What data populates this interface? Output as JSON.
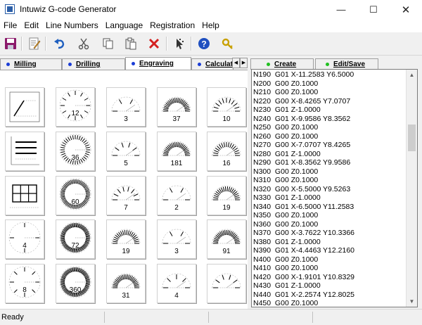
{
  "window": {
    "title": "Intuwiz G-code Generator",
    "controls": [
      "minimize-icon",
      "maximize-icon",
      "close-icon"
    ]
  },
  "menu": [
    "File",
    "Edit",
    "Line Numbers",
    "Language",
    "Registration",
    "Help"
  ],
  "toolbar": {
    "buttons": [
      "save-icon",
      "edit-icon",
      "undo-icon",
      "cut-icon",
      "copy-icon",
      "paste-icon",
      "delete-icon",
      "pointer-icon",
      "help-icon",
      "key-icon"
    ]
  },
  "tabs": [
    {
      "label": "Milling",
      "active": false
    },
    {
      "label": "Drilling",
      "active": false
    },
    {
      "label": "Engraving",
      "active": true
    },
    {
      "label": "Calculators",
      "active": false
    }
  ],
  "tab_dot_color": "#1a3cd6",
  "right_tabs": [
    {
      "label": "Create"
    },
    {
      "label": "Edit/Save"
    }
  ],
  "right_tab_dot_color": "#20c020",
  "tiles": [
    [
      "",
      "12",
      "3",
      "37",
      "10"
    ],
    [
      "",
      "36",
      "5",
      "181",
      "16"
    ],
    [
      "",
      "60",
      "7",
      "2",
      "19"
    ],
    [
      "4",
      "72",
      "19",
      "3",
      "91"
    ],
    [
      "8",
      "360",
      "31",
      "4",
      ""
    ]
  ],
  "gcode": [
    "N190  G01 X-11.2583 Y6.5000",
    "N200  G00 Z0.1000",
    "N210  G00 Z0.1000",
    "N220  G00 X-8.4265 Y7.0707",
    "N230  G01 Z-1.0000",
    "N240  G01 X-9.9586 Y8.3562",
    "N250  G00 Z0.1000",
    "N260  G00 Z0.1000",
    "N270  G00 X-7.0707 Y8.4265",
    "N280  G01 Z-1.0000",
    "N290  G01 X-8.3562 Y9.9586",
    "N300  G00 Z0.1000",
    "N310  G00 Z0.1000",
    "N320  G00 X-5.5000 Y9.5263",
    "N330  G01 Z-1.0000",
    "N340  G01 X-6.5000 Y11.2583",
    "N350  G00 Z0.1000",
    "N360  G00 Z0.1000",
    "N370  G00 X-3.7622 Y10.3366",
    "N380  G01 Z-1.0000",
    "N390  G01 X-4.4463 Y12.2160",
    "N400  G00 Z0.1000",
    "N410  G00 Z0.1000",
    "N420  G00 X-1.9101 Y10.8329",
    "N430  G01 Z-1.0000",
    "N440  G01 X-2.2574 Y12.8025",
    "N450  G00 Z0.1000"
  ],
  "status": "Ready"
}
